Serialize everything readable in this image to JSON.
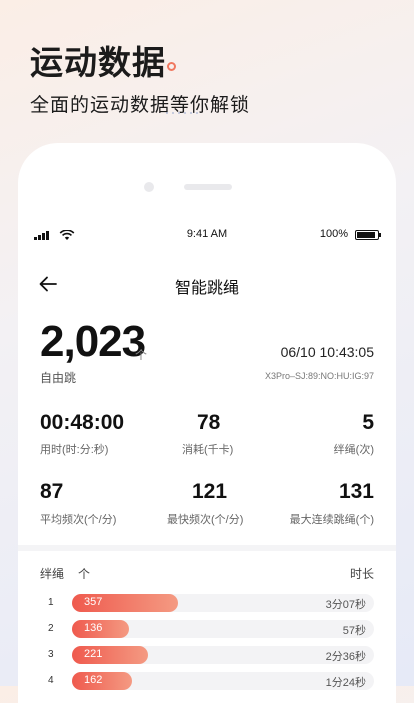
{
  "promo": {
    "title": "运动数据",
    "subtitle": "全面的运动数据等你解锁"
  },
  "status_bar": {
    "time": "9:41 AM",
    "battery": "100%"
  },
  "nav": {
    "title": "智能跳绳"
  },
  "summary": {
    "count": "2,023",
    "count_unit": "个",
    "mode": "自由跳",
    "datetime": "06/10 10:43:05",
    "device_id": "X3Pro–SJ:89:NO:HU:IG:97"
  },
  "stats": [
    {
      "value": "00:48:00",
      "label": "用时(时:分:秒)"
    },
    {
      "value": "78",
      "label": "消耗(千卡)"
    },
    {
      "value": "5",
      "label": "绊绳(次)"
    },
    {
      "value": "87",
      "label": "平均频次(个/分)"
    },
    {
      "value": "121",
      "label": "最快频次(个/分)"
    },
    {
      "value": "131",
      "label": "最大连续跳绳(个)"
    }
  ],
  "trips": {
    "header_label": "绊绳",
    "header_unit": "个",
    "header_duration": "时长",
    "rows": [
      {
        "index": "1",
        "count": "357",
        "duration": "3分07秒",
        "fill": 0.35
      },
      {
        "index": "2",
        "count": "136",
        "duration": "57秒",
        "fill": 0.19
      },
      {
        "index": "3",
        "count": "221",
        "duration": "2分36秒",
        "fill": 0.25
      },
      {
        "index": "4",
        "count": "162",
        "duration": "1分24秒",
        "fill": 0.2
      }
    ]
  },
  "colors": {
    "accent": "#ef5a4e",
    "accent_light": "#f49a82",
    "track": "#f3f3f5"
  }
}
